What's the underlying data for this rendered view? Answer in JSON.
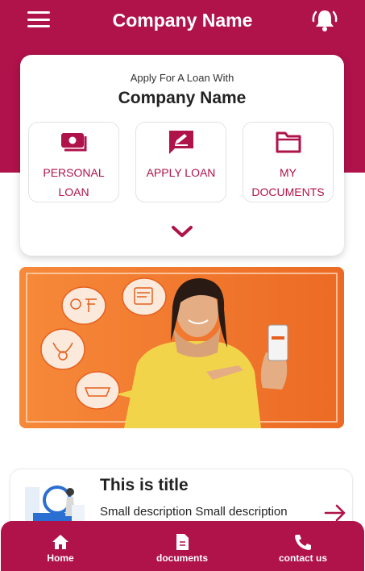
{
  "header": {
    "title": "Company Name",
    "menu_icon": "hamburger-menu-icon",
    "notification_icon": "bell-icon"
  },
  "loan_card": {
    "subtitle": "Apply For A Loan With",
    "title": "Company Name",
    "actions": [
      {
        "label": "PERSONAL LOAN",
        "icon": "cash-icon"
      },
      {
        "label": "APPLY LOAN",
        "icon": "edit-message-icon"
      },
      {
        "label": "MY DOCUMENTS",
        "icon": "folder-icon"
      }
    ],
    "expand_icon": "chevron-down-icon"
  },
  "info_card": {
    "title": "This is title",
    "description": "Small description Small description",
    "arrow_icon": "arrow-right-icon"
  },
  "bottom_nav": [
    {
      "label": "Home",
      "icon": "home-icon"
    },
    {
      "label": "documents",
      "icon": "document-icon"
    },
    {
      "label": "contact us",
      "icon": "phone-icon"
    }
  ],
  "colors": {
    "brand": "#b0124a",
    "banner": "#f07a2c"
  }
}
